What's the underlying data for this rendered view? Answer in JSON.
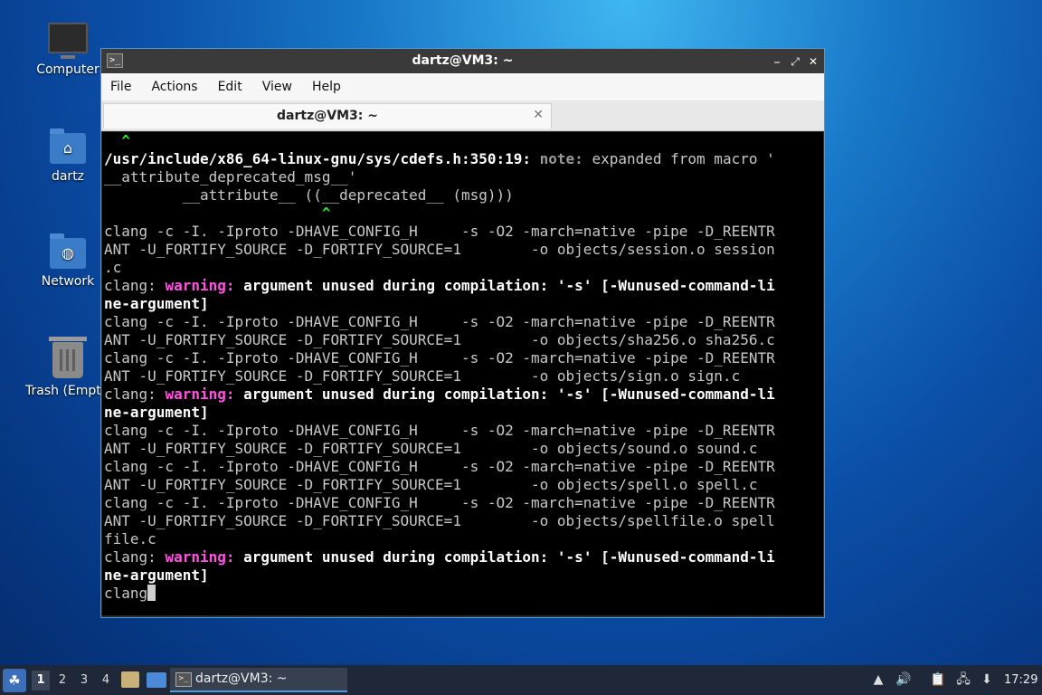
{
  "desktop": {
    "icons": [
      {
        "label": "Computer"
      },
      {
        "label": "dartz"
      },
      {
        "label": "Network"
      },
      {
        "label": "Trash (Empt"
      }
    ]
  },
  "window": {
    "title": "dartz@VM3: ~",
    "menu": [
      "File",
      "Actions",
      "Edit",
      "View",
      "Help"
    ],
    "tab_label": "dartz@VM3: ~",
    "buttons": {
      "minimize": "⎯",
      "maximize": "⤢",
      "close": "✕"
    }
  },
  "terminal": {
    "lines": [
      [
        {
          "t": "  ",
          "c": ""
        },
        {
          "t": "^",
          "c": "caret"
        }
      ],
      [
        {
          "t": "/usr/include/x86_64-linux-gnu/sys/cdefs.h:350:19: ",
          "c": "b"
        },
        {
          "t": "note:",
          "c": "note"
        },
        {
          "t": " expanded from macro '",
          "c": ""
        }
      ],
      [
        {
          "t": "__attribute_deprecated_msg__'",
          "c": ""
        }
      ],
      [
        {
          "t": "         __attribute__ ((__deprecated__ (msg)))",
          "c": ""
        }
      ],
      [
        {
          "t": "                         ",
          "c": ""
        },
        {
          "t": "^",
          "c": "caret"
        }
      ],
      [
        {
          "t": "clang -c -I. -Iproto -DHAVE_CONFIG_H     -s -O2 -march=native -pipe -D_REENTR",
          "c": ""
        }
      ],
      [
        {
          "t": "ANT -U_FORTIFY_SOURCE -D_FORTIFY_SOURCE=1        -o objects/session.o session",
          "c": ""
        }
      ],
      [
        {
          "t": ".c",
          "c": ""
        }
      ],
      [
        {
          "t": "clang: ",
          "c": ""
        },
        {
          "t": "warning:",
          "c": "warn"
        },
        {
          "t": " argument unused during compilation: '-s' [-Wunused-command-li",
          "c": "b"
        }
      ],
      [
        {
          "t": "ne-argument]",
          "c": "b"
        }
      ],
      [
        {
          "t": "clang -c -I. -Iproto -DHAVE_CONFIG_H     -s -O2 -march=native -pipe -D_REENTR",
          "c": ""
        }
      ],
      [
        {
          "t": "ANT -U_FORTIFY_SOURCE -D_FORTIFY_SOURCE=1        -o objects/sha256.o sha256.c",
          "c": ""
        }
      ],
      [
        {
          "t": "clang -c -I. -Iproto -DHAVE_CONFIG_H     -s -O2 -march=native -pipe -D_REENTR",
          "c": ""
        }
      ],
      [
        {
          "t": "ANT -U_FORTIFY_SOURCE -D_FORTIFY_SOURCE=1        -o objects/sign.o sign.c",
          "c": ""
        }
      ],
      [
        {
          "t": "clang: ",
          "c": ""
        },
        {
          "t": "warning:",
          "c": "warn"
        },
        {
          "t": " argument unused during compilation: '-s' [-Wunused-command-li",
          "c": "b"
        }
      ],
      [
        {
          "t": "ne-argument]",
          "c": "b"
        }
      ],
      [
        {
          "t": "clang -c -I. -Iproto -DHAVE_CONFIG_H     -s -O2 -march=native -pipe -D_REENTR",
          "c": ""
        }
      ],
      [
        {
          "t": "ANT -U_FORTIFY_SOURCE -D_FORTIFY_SOURCE=1        -o objects/sound.o sound.c",
          "c": ""
        }
      ],
      [
        {
          "t": "clang -c -I. -Iproto -DHAVE_CONFIG_H     -s -O2 -march=native -pipe -D_REENTR",
          "c": ""
        }
      ],
      [
        {
          "t": "ANT -U_FORTIFY_SOURCE -D_FORTIFY_SOURCE=1        -o objects/spell.o spell.c",
          "c": ""
        }
      ],
      [
        {
          "t": "clang -c -I. -Iproto -DHAVE_CONFIG_H     -s -O2 -march=native -pipe -D_REENTR",
          "c": ""
        }
      ],
      [
        {
          "t": "ANT -U_FORTIFY_SOURCE -D_FORTIFY_SOURCE=1        -o objects/spellfile.o spell",
          "c": ""
        }
      ],
      [
        {
          "t": "file.c",
          "c": ""
        }
      ],
      [
        {
          "t": "clang: ",
          "c": ""
        },
        {
          "t": "warning:",
          "c": "warn"
        },
        {
          "t": " argument unused during compilation: '-s' [-Wunused-command-li",
          "c": "b"
        }
      ],
      [
        {
          "t": "ne-argument]",
          "c": "b"
        }
      ],
      [
        {
          "t": "clang",
          "c": ""
        },
        {
          "t": "",
          "c": "cursor"
        }
      ]
    ]
  },
  "taskbar": {
    "workspaces": [
      "1",
      "2",
      "3",
      "4"
    ],
    "active_workspace": "1",
    "task_label": "dartz@VM3: ~",
    "clock": "17:29"
  }
}
